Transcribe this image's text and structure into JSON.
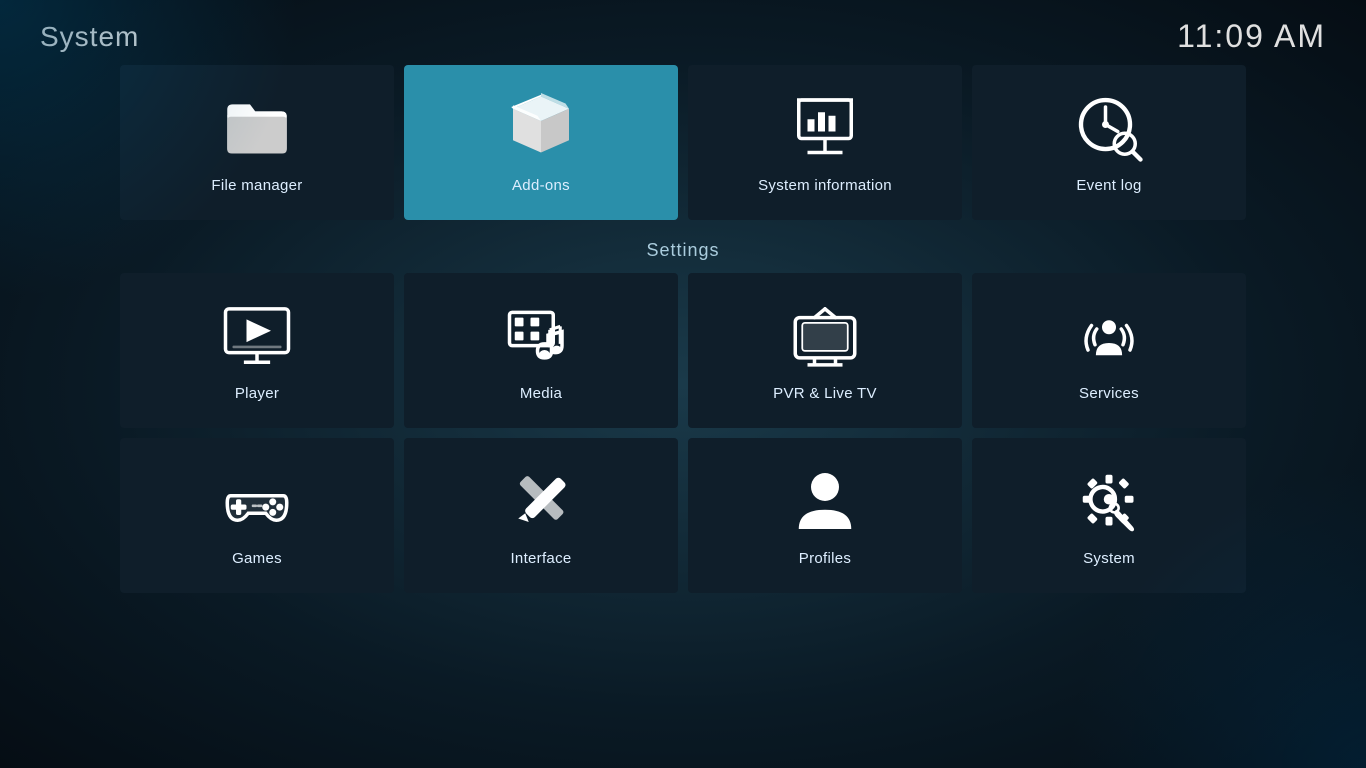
{
  "header": {
    "title": "System",
    "time": "11:09 AM"
  },
  "top_row": [
    {
      "id": "file-manager",
      "label": "File manager",
      "icon": "folder"
    },
    {
      "id": "add-ons",
      "label": "Add-ons",
      "icon": "box",
      "active": true
    },
    {
      "id": "system-information",
      "label": "System information",
      "icon": "chart"
    },
    {
      "id": "event-log",
      "label": "Event log",
      "icon": "clock-search"
    }
  ],
  "settings_label": "Settings",
  "settings_row1": [
    {
      "id": "player",
      "label": "Player",
      "icon": "monitor-play"
    },
    {
      "id": "media",
      "label": "Media",
      "icon": "media"
    },
    {
      "id": "pvr-live-tv",
      "label": "PVR & Live TV",
      "icon": "tv"
    },
    {
      "id": "services",
      "label": "Services",
      "icon": "broadcast"
    }
  ],
  "settings_row2": [
    {
      "id": "games",
      "label": "Games",
      "icon": "gamepad"
    },
    {
      "id": "interface",
      "label": "Interface",
      "icon": "tools"
    },
    {
      "id": "profiles",
      "label": "Profiles",
      "icon": "person"
    },
    {
      "id": "system",
      "label": "System",
      "icon": "gear-wrench"
    }
  ]
}
